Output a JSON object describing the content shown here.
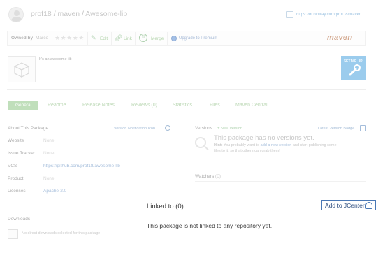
{
  "header": {
    "owner": "prof18",
    "repo": "maven",
    "package": "Awesome-lib",
    "separator": "/",
    "download_url": "https://dl.bintray.com/prof18/maven"
  },
  "toolbar": {
    "owned_by_label": "Owned by",
    "owner_name": "Marco",
    "stars": "★★★★★",
    "edit_label": "Edit",
    "link_label": "Link",
    "merge_label": "Merge",
    "upgrade_label": "Upgrade to Premium",
    "brand": "maven"
  },
  "package": {
    "description": "It's an awesome lib",
    "set_me_up": "SET ME UP!"
  },
  "tabs": [
    {
      "label": "General",
      "active": true
    },
    {
      "label": "Readme"
    },
    {
      "label": "Release Notes"
    },
    {
      "label": "Reviews (0)"
    },
    {
      "label": "Statistics"
    },
    {
      "label": "Files"
    },
    {
      "label": "Maven Central"
    }
  ],
  "about": {
    "title": "About This Package",
    "notifications_link": "Version Notification Icon",
    "rows": [
      {
        "label": "Website",
        "value": "None"
      },
      {
        "label": "Issue Tracker",
        "value": "None"
      },
      {
        "label": "VCS",
        "value": "https://github.com/prof18/awesome-lib"
      },
      {
        "label": "Product",
        "value": "None"
      },
      {
        "label": "Licenses",
        "value": "Apache-2.0"
      }
    ]
  },
  "downloads": {
    "title": "Downloads",
    "note": "No direct downloads selected for this package"
  },
  "versions": {
    "title": "Versions",
    "new_version": "New Version",
    "badge_link": "Latest Version Badge",
    "empty_title": "This package has no versions yet.",
    "hint_prefix": "Hint:",
    "hint_text": "You probably want to",
    "hint_link": "add a new version",
    "hint_rest": "and start publishing some",
    "hint_line2": "files to it, so that others can grab them!"
  },
  "watchers": {
    "title": "Watchers",
    "count": "(0)"
  },
  "linked": {
    "title": "Linked to (0)",
    "button_label": "Add to JCenter",
    "message": "This package is not linked to any repository yet."
  },
  "colors": {
    "accent_green": "#8dc585",
    "link_blue": "#5a87bd",
    "set_me_up_blue": "#4aa3df",
    "maven_brand": "#b06030"
  }
}
